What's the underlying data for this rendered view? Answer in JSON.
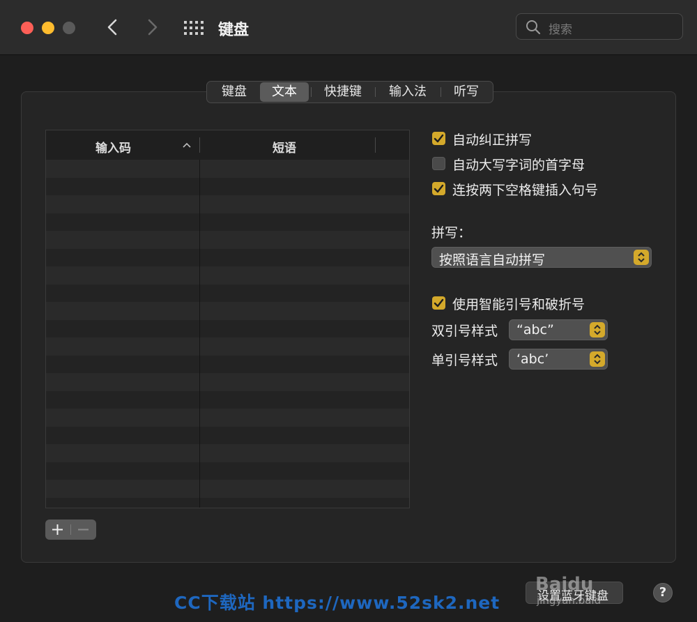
{
  "window": {
    "title": "键盘",
    "search_placeholder": "搜索",
    "traffic_colors": {
      "close": "#fe5f57",
      "minimize": "#febc2e",
      "zoom": "#5a5a5a"
    }
  },
  "tabs": [
    {
      "label": "键盘",
      "active": false
    },
    {
      "label": "文本",
      "active": true
    },
    {
      "label": "快捷键",
      "active": false
    },
    {
      "label": "输入法",
      "active": false
    },
    {
      "label": "听写",
      "active": false
    }
  ],
  "table": {
    "col_input": "输入码",
    "col_phrase": "短语",
    "sort_indicator": "^",
    "rows": []
  },
  "table_buttons": {
    "add": "+",
    "remove": "−"
  },
  "options": {
    "autocorrect": {
      "label": "自动纠正拼写",
      "checked": true
    },
    "autocap": {
      "label": "自动大写字词的首字母",
      "checked": false
    },
    "period": {
      "label": "连按两下空格键插入句号",
      "checked": true
    }
  },
  "spelling": {
    "label": "拼写：",
    "value": "按照语言自动拼写"
  },
  "smart_quotes": {
    "label": "使用智能引号和破折号",
    "checked": true
  },
  "double_quote": {
    "label": "双引号样式",
    "value": "“abc”"
  },
  "single_quote": {
    "label": "单引号样式",
    "value": "‘abc’"
  },
  "footer": {
    "bt_button": "设置蓝牙键盘",
    "help": "?"
  },
  "watermarks": {
    "site": "CC下载站 https://www.52sk2.net",
    "baidu": "Baidu",
    "jingyan": "jingyan.baid"
  },
  "accent_color": "#d4a92b"
}
